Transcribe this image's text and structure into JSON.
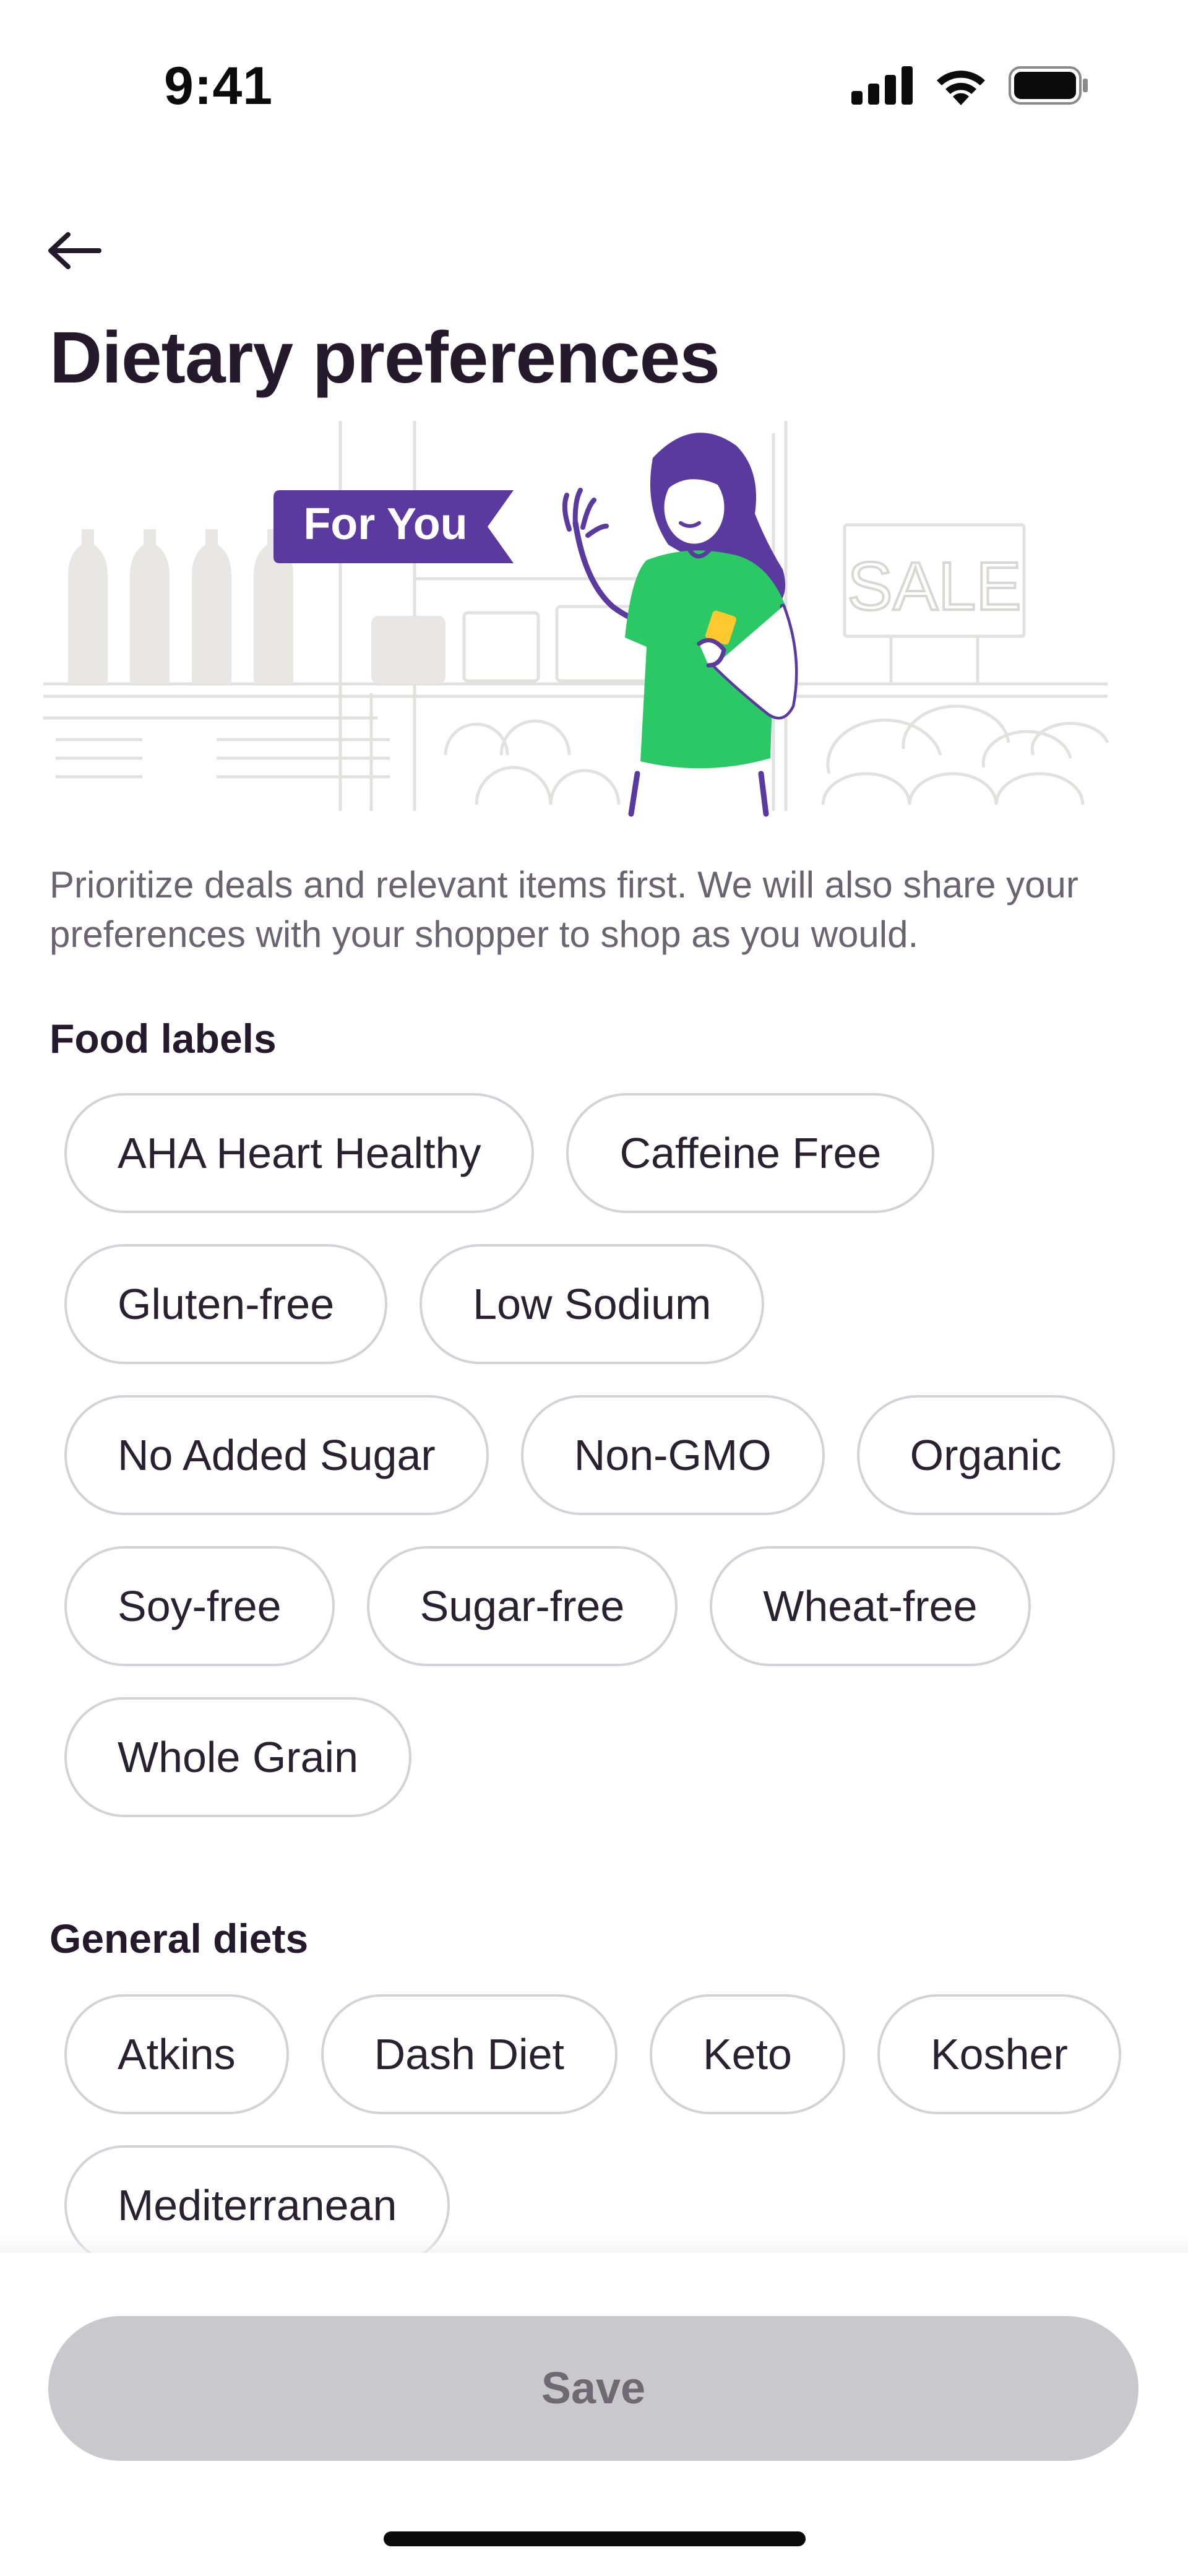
{
  "status_bar": {
    "time": "9:41",
    "icons": [
      "cellular-signal-icon",
      "wifi-icon",
      "battery-icon"
    ]
  },
  "header": {
    "back_icon": "arrow-left-icon",
    "title": "Dietary preferences"
  },
  "hero": {
    "badge": "For You",
    "sign": "SALE"
  },
  "description": "Prioritize deals and relevant items first. We will also share your preferences with your shopper to shop as you would.",
  "food_labels": {
    "title": "Food labels",
    "items": [
      "AHA Heart Healthy",
      "Caffeine Free",
      "Gluten-free",
      "Low Sodium",
      "No Added Sugar",
      "Non-GMO",
      "Organic",
      "Soy-free",
      "Sugar-free",
      "Wheat-free",
      "Whole Grain"
    ]
  },
  "general_diets": {
    "title": "General diets",
    "items": [
      "Atkins",
      "Dash Diet",
      "Keto",
      "Kosher",
      "Mediterranean"
    ]
  },
  "footer": {
    "save_label": "Save"
  },
  "colors": {
    "brand_purple": "#5a3a9f",
    "shirt_green": "#2bc965",
    "chip_border": "#d4d2d6",
    "save_disabled_bg": "#c9c8cc",
    "text_primary": "#241a2c",
    "text_secondary": "#6b6470"
  }
}
